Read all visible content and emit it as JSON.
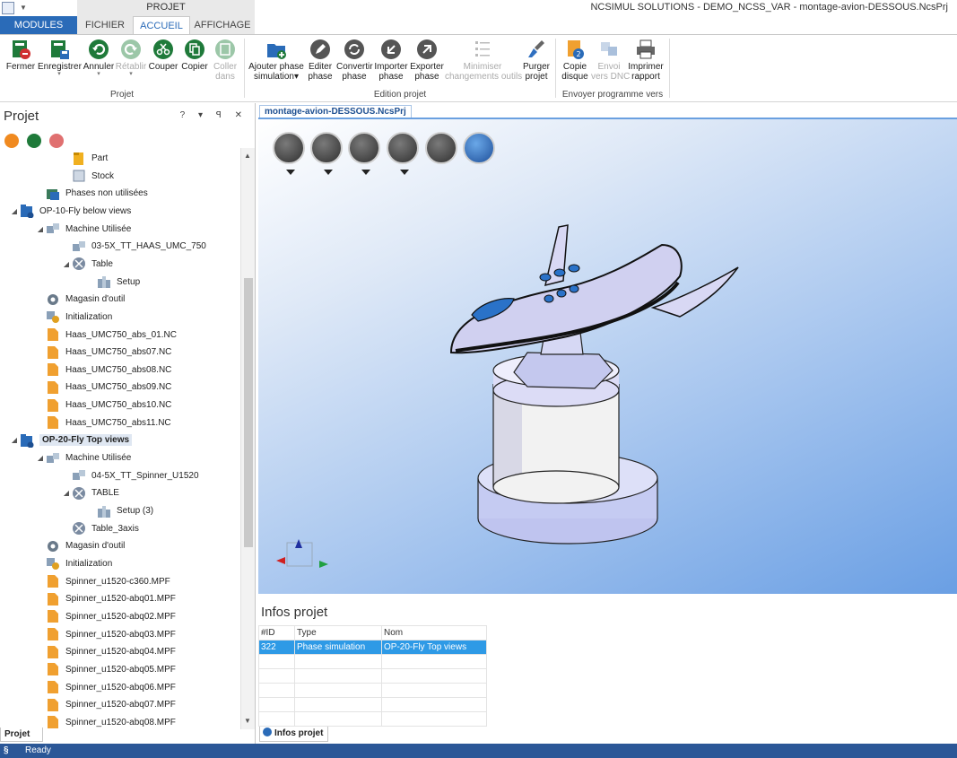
{
  "window": {
    "title": "NCSIMUL SOLUTIONS - DEMO_NCSS_VAR - montage-avion-DESSOUS.NcsPrj",
    "context_tab": "PROJET"
  },
  "tabs": [
    {
      "label": "MODULES",
      "active": false
    },
    {
      "label": "FICHIER",
      "active": false
    },
    {
      "label": "ACCUEIL",
      "active": true
    },
    {
      "label": "AFFICHAGE",
      "active": false
    }
  ],
  "ribbon": {
    "groups": {
      "projet": "Projet",
      "edition": "Edition projet",
      "envoyer": "Envoyer programme vers"
    },
    "buttons": {
      "fermer": "Fermer",
      "enregistrer": "Enregistrer",
      "annuler": "Annuler",
      "retablir": "Rétablir",
      "couper": "Couper",
      "copier": "Copier",
      "coller_1": "Coller",
      "coller_2": "dans",
      "ajouter_1": "Ajouter phase",
      "ajouter_2": "simulation",
      "editer_1": "Editer",
      "editer_2": "phase",
      "convertir_1": "Convertir",
      "convertir_2": "phase",
      "importer_1": "Importer",
      "importer_2": "phase",
      "exporter_1": "Exporter",
      "exporter_2": "phase",
      "minimiser_1": "Minimiser",
      "minimiser_2": "changements outils",
      "purger_1": "Purger",
      "purger_2": "projet",
      "copie_1": "Copie",
      "copie_2": "disque",
      "envoi_1": "Envoi",
      "envoi_2": "vers DNC",
      "imprimer_1": "Imprimer",
      "imprimer_2": "rapport"
    }
  },
  "left_panel": {
    "title": "Projet",
    "controls": "? ▾ ꟼ ✕",
    "tab_label": "Projet",
    "tree": [
      {
        "label": "Part",
        "icon": "folder-yellow-icon"
      },
      {
        "label": "Stock",
        "icon": "stock-icon"
      },
      {
        "label": "Phases non utilisées",
        "icon": "phases-icon"
      },
      {
        "label": "OP-10-Fly below views",
        "icon": "operation-icon"
      },
      {
        "label": "Machine Utilisée",
        "icon": "machine-icon"
      },
      {
        "label": "03-5X_TT_HAAS_UMC_750",
        "icon": "machine-icon"
      },
      {
        "label": "Table",
        "icon": "table-icon"
      },
      {
        "label": "Setup",
        "icon": "setup-icon"
      },
      {
        "label": "Magasin d'outil",
        "icon": "gear-icon"
      },
      {
        "label": "Initialization",
        "icon": "init-icon"
      },
      {
        "label": "Haas_UMC750_abs_01.NC",
        "icon": "nc-file-icon"
      },
      {
        "label": "Haas_UMC750_abs07.NC",
        "icon": "nc-file-icon"
      },
      {
        "label": "Haas_UMC750_abs08.NC",
        "icon": "nc-file-icon"
      },
      {
        "label": "Haas_UMC750_abs09.NC",
        "icon": "nc-file-icon"
      },
      {
        "label": "Haas_UMC750_abs10.NC",
        "icon": "nc-file-icon"
      },
      {
        "label": "Haas_UMC750_abs11.NC",
        "icon": "nc-file-icon"
      },
      {
        "label": "OP-20-Fly Top views",
        "icon": "operation-icon",
        "selected": true
      },
      {
        "label": "Machine Utilisée",
        "icon": "machine-icon"
      },
      {
        "label": "04-5X_TT_Spinner_U1520",
        "icon": "machine-icon"
      },
      {
        "label": "TABLE",
        "icon": "table-icon"
      },
      {
        "label": "Setup (3)",
        "icon": "setup-icon"
      },
      {
        "label": "Table_3axis",
        "icon": "table-icon"
      },
      {
        "label": "Magasin d'outil",
        "icon": "gear-icon"
      },
      {
        "label": "Initialization",
        "icon": "init-icon"
      },
      {
        "label": "Spinner_u1520-c360.MPF",
        "icon": "nc-file-icon"
      },
      {
        "label": "Spinner_u1520-abq01.MPF",
        "icon": "nc-file-icon"
      },
      {
        "label": "Spinner_u1520-abq02.MPF",
        "icon": "nc-file-icon"
      },
      {
        "label": "Spinner_u1520-abq03.MPF",
        "icon": "nc-file-icon"
      },
      {
        "label": "Spinner_u1520-abq04.MPF",
        "icon": "nc-file-icon"
      },
      {
        "label": "Spinner_u1520-abq05.MPF",
        "icon": "nc-file-icon"
      },
      {
        "label": "Spinner_u1520-abq06.MPF",
        "icon": "nc-file-icon"
      },
      {
        "label": "Spinner_u1520-abq07.MPF",
        "icon": "nc-file-icon"
      },
      {
        "label": "Spinner_u1520-abq08.MPF",
        "icon": "nc-file-icon"
      }
    ]
  },
  "viewport": {
    "doc_tab": "montage-avion-DESSOUS.NcsPrj",
    "toolbar": [
      "view-cube-icon",
      "part-view-icon",
      "cylinder-icon",
      "zoom-icon",
      "select-remove-icon",
      "rotate-view-icon"
    ],
    "colors": {
      "background_top": "#ffffff",
      "background_bottom": "#6a9fe4",
      "model": "#c8c8ee",
      "windows": "#2a72c8"
    }
  },
  "infos": {
    "title": "Infos projet",
    "tab_label": "Infos projet",
    "columns": [
      "#ID",
      "Type",
      "Nom"
    ],
    "rows": [
      [
        "322",
        "Phase simulation",
        "OP-20-Fly Top views"
      ]
    ]
  },
  "status": {
    "text": "Ready"
  },
  "colors": {
    "accent": "#2a6bb8",
    "status_bar": "#2b5797",
    "selection": "#2e9ae6",
    "green_button": "#1f7a3a",
    "orange_file": "#f0a030"
  }
}
